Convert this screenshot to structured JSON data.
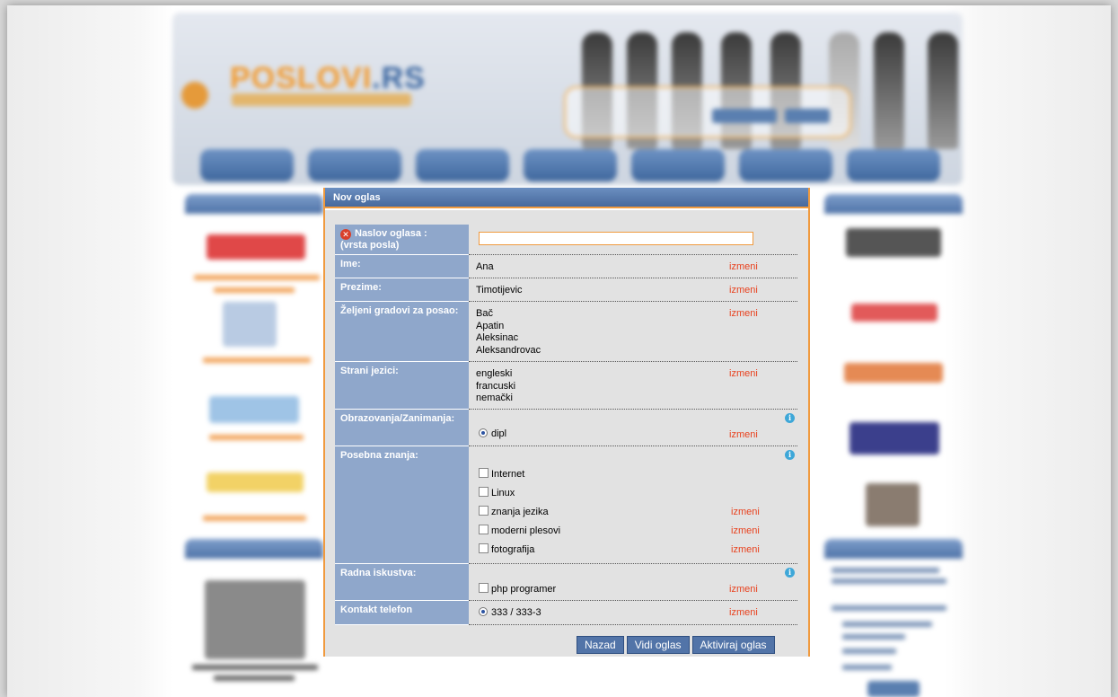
{
  "header": {
    "logo_main": "POSLOVI",
    "logo_ext": ".RS"
  },
  "form": {
    "title": "Nov oglas",
    "edit_label": "izmeni",
    "rows": {
      "naslov": {
        "label_line1": "Naslov oglasa :",
        "label_line2": "(vrsta posla)",
        "input_value": ""
      },
      "ime": {
        "label": "Ime:",
        "value": "Ana"
      },
      "prezime": {
        "label": "Prezime:",
        "value": "Timotijevic"
      },
      "gradovi": {
        "label": "Željeni gradovi za posao:",
        "values": [
          "Bač",
          "Apatin",
          "Aleksinac",
          "Aleksandrovac"
        ]
      },
      "jezici": {
        "label": "Strani jezici:",
        "values": [
          "engleski",
          "francuski",
          "nemački"
        ]
      },
      "obrazovanje": {
        "label": "Obrazovanja/Zanimanja:",
        "option": "dipl"
      },
      "znanja": {
        "label": "Posebna znanja:",
        "options": [
          "Internet",
          "Linux",
          "znanja jezika",
          "moderni plesovi",
          "fotografija"
        ]
      },
      "iskustva": {
        "label": "Radna iskustva:",
        "option": "php programer"
      },
      "telefon": {
        "label": "Kontakt telefon",
        "value": "333 / 333-3"
      }
    },
    "buttons": {
      "back": "Nazad",
      "preview": "Vidi oglas",
      "activate": "Aktiviraj oglas"
    }
  },
  "icons": {
    "error": "error-x-icon",
    "info": "info-icon",
    "colors": {
      "accent": "#f09a3e",
      "label_bg": "#8fa7cb",
      "button_bg": "#5274a8",
      "edit_link": "#e8421f"
    }
  }
}
